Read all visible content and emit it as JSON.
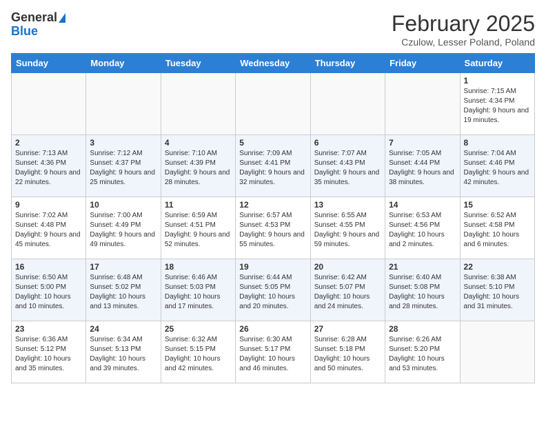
{
  "header": {
    "logo_line1": "General",
    "logo_line2": "Blue",
    "month": "February 2025",
    "location": "Czulow, Lesser Poland, Poland"
  },
  "weekdays": [
    "Sunday",
    "Monday",
    "Tuesday",
    "Wednesday",
    "Thursday",
    "Friday",
    "Saturday"
  ],
  "weeks": [
    [
      {
        "day": "",
        "info": ""
      },
      {
        "day": "",
        "info": ""
      },
      {
        "day": "",
        "info": ""
      },
      {
        "day": "",
        "info": ""
      },
      {
        "day": "",
        "info": ""
      },
      {
        "day": "",
        "info": ""
      },
      {
        "day": "1",
        "info": "Sunrise: 7:15 AM\nSunset: 4:34 PM\nDaylight: 9 hours and 19 minutes."
      }
    ],
    [
      {
        "day": "2",
        "info": "Sunrise: 7:13 AM\nSunset: 4:36 PM\nDaylight: 9 hours and 22 minutes."
      },
      {
        "day": "3",
        "info": "Sunrise: 7:12 AM\nSunset: 4:37 PM\nDaylight: 9 hours and 25 minutes."
      },
      {
        "day": "4",
        "info": "Sunrise: 7:10 AM\nSunset: 4:39 PM\nDaylight: 9 hours and 28 minutes."
      },
      {
        "day": "5",
        "info": "Sunrise: 7:09 AM\nSunset: 4:41 PM\nDaylight: 9 hours and 32 minutes."
      },
      {
        "day": "6",
        "info": "Sunrise: 7:07 AM\nSunset: 4:43 PM\nDaylight: 9 hours and 35 minutes."
      },
      {
        "day": "7",
        "info": "Sunrise: 7:05 AM\nSunset: 4:44 PM\nDaylight: 9 hours and 38 minutes."
      },
      {
        "day": "8",
        "info": "Sunrise: 7:04 AM\nSunset: 4:46 PM\nDaylight: 9 hours and 42 minutes."
      }
    ],
    [
      {
        "day": "9",
        "info": "Sunrise: 7:02 AM\nSunset: 4:48 PM\nDaylight: 9 hours and 45 minutes."
      },
      {
        "day": "10",
        "info": "Sunrise: 7:00 AM\nSunset: 4:49 PM\nDaylight: 9 hours and 49 minutes."
      },
      {
        "day": "11",
        "info": "Sunrise: 6:59 AM\nSunset: 4:51 PM\nDaylight: 9 hours and 52 minutes."
      },
      {
        "day": "12",
        "info": "Sunrise: 6:57 AM\nSunset: 4:53 PM\nDaylight: 9 hours and 55 minutes."
      },
      {
        "day": "13",
        "info": "Sunrise: 6:55 AM\nSunset: 4:55 PM\nDaylight: 9 hours and 59 minutes."
      },
      {
        "day": "14",
        "info": "Sunrise: 6:53 AM\nSunset: 4:56 PM\nDaylight: 10 hours and 2 minutes."
      },
      {
        "day": "15",
        "info": "Sunrise: 6:52 AM\nSunset: 4:58 PM\nDaylight: 10 hours and 6 minutes."
      }
    ],
    [
      {
        "day": "16",
        "info": "Sunrise: 6:50 AM\nSunset: 5:00 PM\nDaylight: 10 hours and 10 minutes."
      },
      {
        "day": "17",
        "info": "Sunrise: 6:48 AM\nSunset: 5:02 PM\nDaylight: 10 hours and 13 minutes."
      },
      {
        "day": "18",
        "info": "Sunrise: 6:46 AM\nSunset: 5:03 PM\nDaylight: 10 hours and 17 minutes."
      },
      {
        "day": "19",
        "info": "Sunrise: 6:44 AM\nSunset: 5:05 PM\nDaylight: 10 hours and 20 minutes."
      },
      {
        "day": "20",
        "info": "Sunrise: 6:42 AM\nSunset: 5:07 PM\nDaylight: 10 hours and 24 minutes."
      },
      {
        "day": "21",
        "info": "Sunrise: 6:40 AM\nSunset: 5:08 PM\nDaylight: 10 hours and 28 minutes."
      },
      {
        "day": "22",
        "info": "Sunrise: 6:38 AM\nSunset: 5:10 PM\nDaylight: 10 hours and 31 minutes."
      }
    ],
    [
      {
        "day": "23",
        "info": "Sunrise: 6:36 AM\nSunset: 5:12 PM\nDaylight: 10 hours and 35 minutes."
      },
      {
        "day": "24",
        "info": "Sunrise: 6:34 AM\nSunset: 5:13 PM\nDaylight: 10 hours and 39 minutes."
      },
      {
        "day": "25",
        "info": "Sunrise: 6:32 AM\nSunset: 5:15 PM\nDaylight: 10 hours and 42 minutes."
      },
      {
        "day": "26",
        "info": "Sunrise: 6:30 AM\nSunset: 5:17 PM\nDaylight: 10 hours and 46 minutes."
      },
      {
        "day": "27",
        "info": "Sunrise: 6:28 AM\nSunset: 5:18 PM\nDaylight: 10 hours and 50 minutes."
      },
      {
        "day": "28",
        "info": "Sunrise: 6:26 AM\nSunset: 5:20 PM\nDaylight: 10 hours and 53 minutes."
      },
      {
        "day": "",
        "info": ""
      }
    ]
  ]
}
